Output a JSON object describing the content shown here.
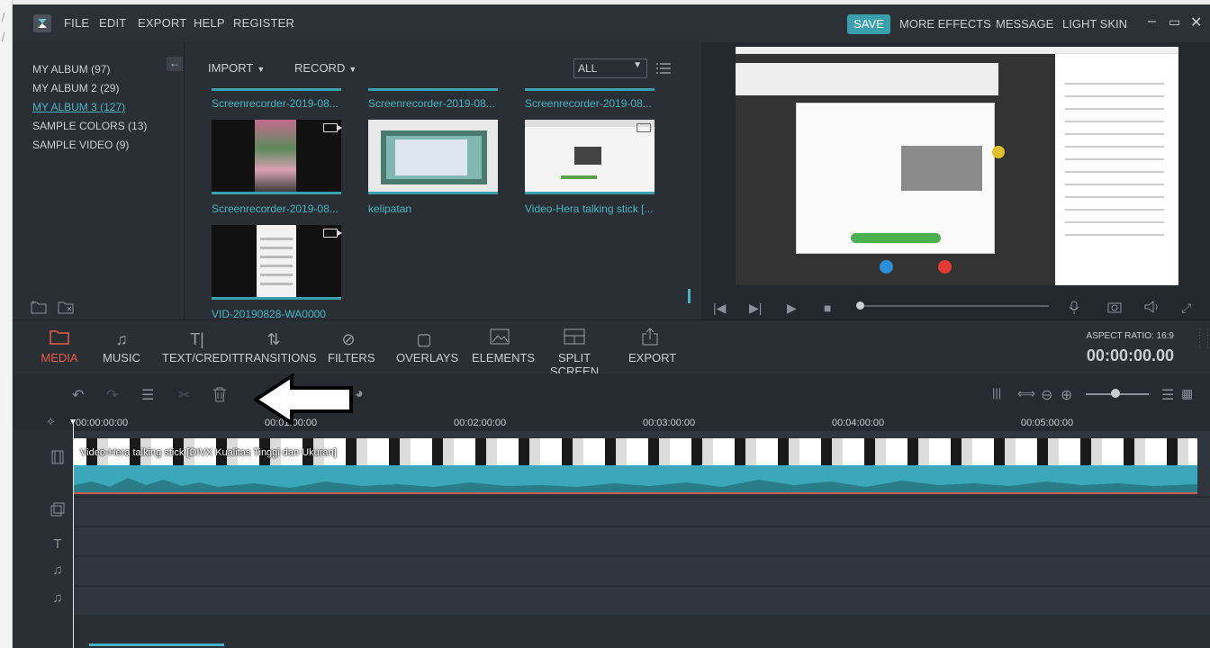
{
  "menu": {
    "file": "FILE",
    "edit": "EDIT",
    "export": "EXPORT",
    "help": "HELP",
    "register": "REGISTER"
  },
  "header_right": {
    "save": "SAVE",
    "more_effects": "MORE EFFECTS",
    "message": "MESSAGE",
    "light_skin": "LIGHT SKIN"
  },
  "albums": [
    {
      "label": "MY ALBUM (97)"
    },
    {
      "label": "MY ALBUM 2 (29)"
    },
    {
      "label": "MY ALBUM 3 (127)"
    },
    {
      "label": "SAMPLE COLORS (13)"
    },
    {
      "label": "SAMPLE VIDEO (9)"
    }
  ],
  "media_toolbar": {
    "import": "IMPORT",
    "record": "RECORD",
    "filter": "ALL"
  },
  "media_items": [
    {
      "label": "Screenrecorder-2019-08..."
    },
    {
      "label": "Screenrecorder-2019-08..."
    },
    {
      "label": "Screenrecorder-2019-08..."
    },
    {
      "label": "Screenrecorder-2019-08..."
    },
    {
      "label": "kelipatan"
    },
    {
      "label": "Video-Hera talking stick [..."
    },
    {
      "label": "VID-20190828-WA0000"
    }
  ],
  "tools": {
    "media": "MEDIA",
    "music": "MUSIC",
    "text": "TEXT/CREDIT",
    "transitions": "TRANSITIONS",
    "filters": "FILTERS",
    "overlays": "OVERLAYS",
    "elements": "ELEMENTS",
    "split": "SPLIT SCREEN",
    "export": "EXPORT"
  },
  "aspect_ratio": "ASPECT RATIO: 16:9",
  "timecode": "00:00:00.00",
  "ruler": [
    "00:00:00:00",
    "00:01:00:00",
    "00:02:00:00",
    "00:03:00:00",
    "00:04:00:00",
    "00:05:00:00"
  ],
  "clip_title": "Video-Hera talking stick [DIVX Kualitas Tinggi dan Ukuran]",
  "colors": {
    "accent": "#3ba0ae",
    "active": "#e95a47",
    "bg": "#2a2f36"
  },
  "icons": [
    "logo-icon",
    "back-arrow-icon",
    "list-view-icon",
    "camera-icon",
    "undo-icon",
    "redo-icon",
    "adjust-icon",
    "cut-icon",
    "delete-icon",
    "palette-icon",
    "play-icon",
    "stop-icon",
    "mic-icon",
    "snapshot-icon",
    "volume-icon",
    "fullscreen-icon"
  ]
}
